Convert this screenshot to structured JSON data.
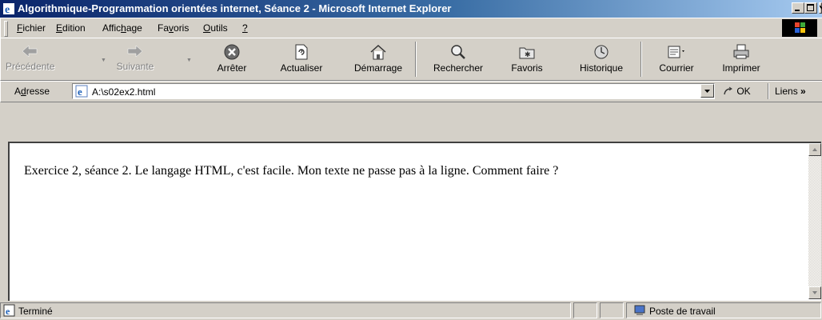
{
  "window": {
    "title": "Algorithmique-Programmation orientées internet, Séance 2 - Microsoft Internet Explorer"
  },
  "menu": {
    "items": [
      {
        "pre": "",
        "key": "F",
        "post": "ichier"
      },
      {
        "pre": "",
        "key": "E",
        "post": "dition"
      },
      {
        "pre": "Affic",
        "key": "h",
        "post": "age"
      },
      {
        "pre": "Fa",
        "key": "v",
        "post": "oris"
      },
      {
        "pre": "",
        "key": "O",
        "post": "utils"
      },
      {
        "pre": "",
        "key": "?",
        "post": ""
      }
    ]
  },
  "toolbar": {
    "back": "Précédente",
    "forward": "Suivante",
    "stop": "Arrêter",
    "refresh": "Actualiser",
    "home": "Démarrage",
    "search": "Rechercher",
    "favorites": "Favoris",
    "history": "Historique",
    "mail": "Courrier",
    "print": "Imprimer"
  },
  "address": {
    "label_pre": "A",
    "label_key": "d",
    "label_post": "resse",
    "value": "A:\\s02ex2.html",
    "go_label": "OK",
    "links_label": "Liens",
    "links_chevron": "»"
  },
  "page": {
    "text": "Exercice 2, séance 2. Le langage HTML, c'est facile. Mon texte ne passe pas à la ligne. Comment faire ?"
  },
  "status": {
    "text": "Terminé",
    "zone": "Poste de travail"
  },
  "colors": {
    "title_start": "#0a246a",
    "title_end": "#a6caf0",
    "chrome": "#d4d0c8"
  },
  "icons": {
    "back": "back-arrow-icon",
    "forward": "forward-arrow-icon",
    "stop": "stop-icon",
    "refresh": "refresh-icon",
    "home": "home-icon",
    "search": "search-icon",
    "favorites": "favorites-icon",
    "history": "history-icon",
    "mail": "mail-icon",
    "print": "printer-icon"
  }
}
